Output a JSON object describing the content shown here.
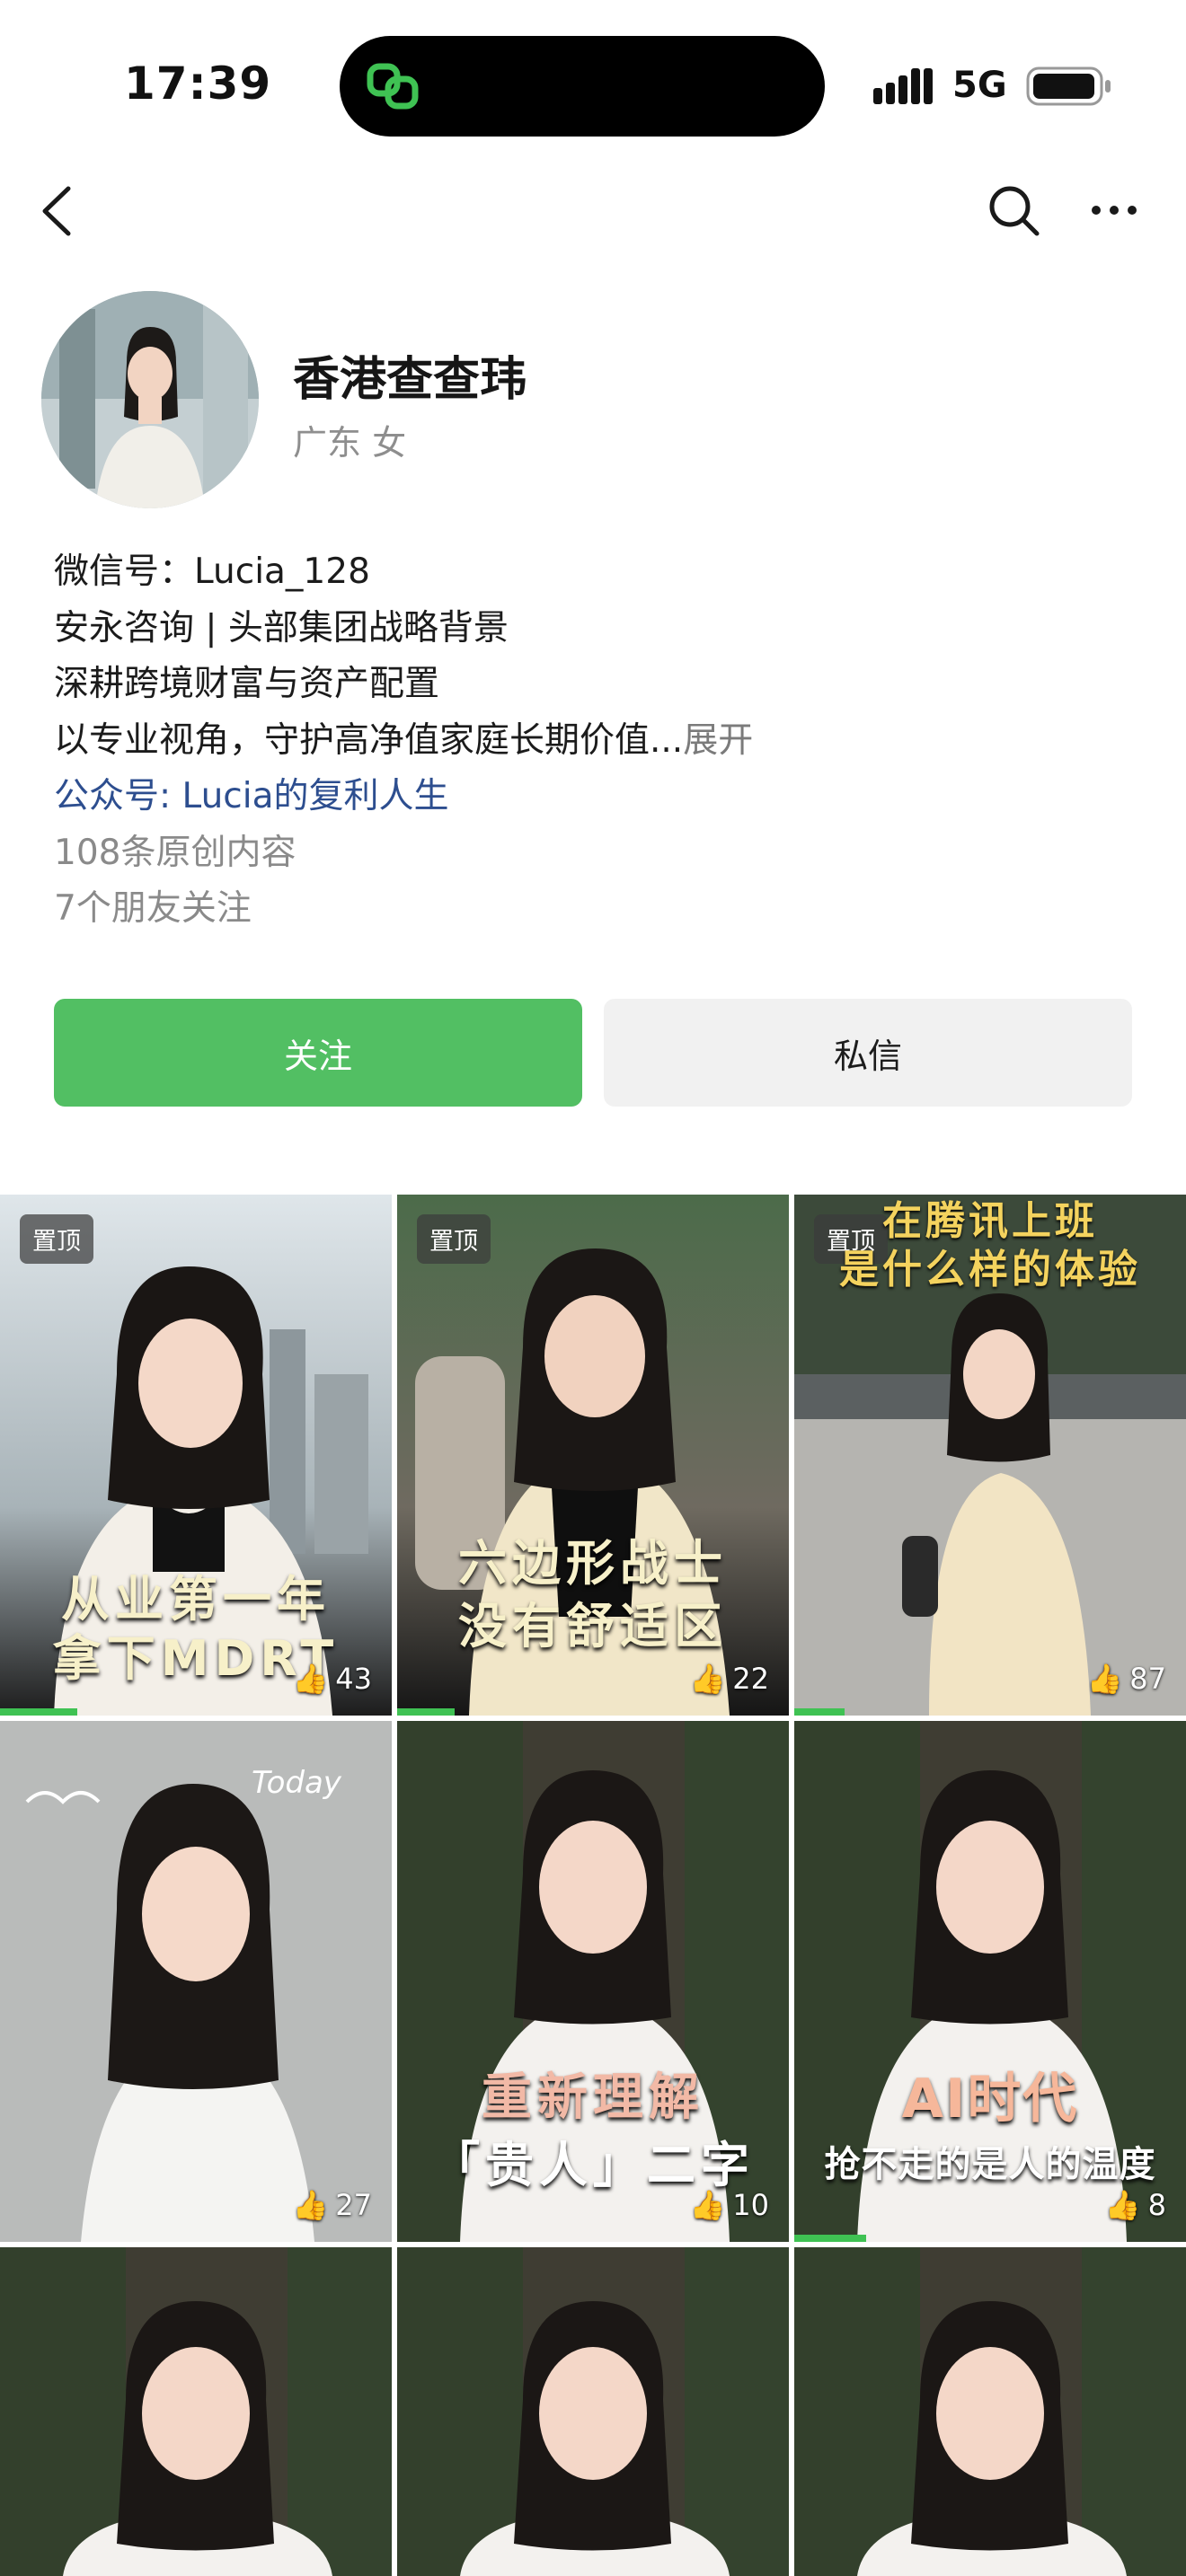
{
  "status": {
    "time": "17:39",
    "network": "5G"
  },
  "profile": {
    "name": "香港查查玮",
    "location_gender": "广东 女",
    "wechat_id": "微信号：Lucia_128",
    "bio_line1": "安永咨询 | 头部集团战略背景",
    "bio_line2": "深耕跨境财富与资产配置",
    "bio_line3": "以专业视角，守护高净值家庭长期价值...",
    "expand_label": "展开",
    "official_account": "公众号: Lucia的复利人生",
    "original_count": "108条原创内容",
    "friends_following": "7个朋友关注"
  },
  "actions": {
    "follow_label": "关注",
    "message_label": "私信"
  },
  "colors": {
    "accent_green": "#52bf63",
    "link_blue": "#2d4e8f"
  },
  "videos": [
    {
      "pinned": "置顶",
      "caption_line1": "从业第一年",
      "caption_line2": "拿下MDRT",
      "likes": "43",
      "progress": 0.2
    },
    {
      "pinned": "置顶",
      "caption_line1": "六边形战士",
      "caption_line2": "没有舒适区",
      "likes": "22",
      "progress": 0.15
    },
    {
      "pinned": "置顶",
      "caption_line1": "在腾讯上班",
      "caption_line2": "是什么样的体验",
      "likes": "87",
      "progress": 0.13
    },
    {
      "caption_line1": "",
      "caption_line2": "",
      "likes": "27"
    },
    {
      "caption_line1": "重新理解",
      "caption_line2": "「贵人」二字",
      "likes": "10"
    },
    {
      "caption_line1": "AI时代",
      "caption_line2": "抢不走的是人的温度",
      "likes": "8",
      "progress": 0.18
    },
    {
      "caption_line1": "",
      "caption_line2": ""
    },
    {
      "caption_line1": "",
      "caption_line2": ""
    },
    {
      "caption_line1": "",
      "caption_line2": ""
    }
  ]
}
